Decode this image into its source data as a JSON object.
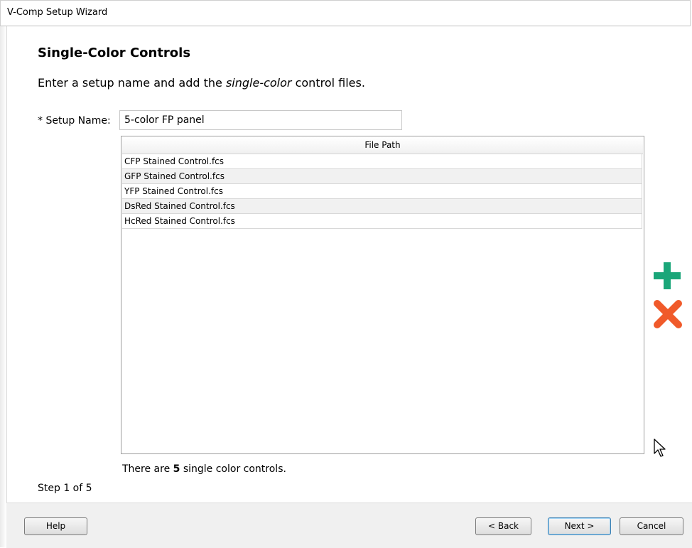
{
  "window": {
    "title": "V-Comp Setup Wizard"
  },
  "page": {
    "heading": "Single-Color Controls",
    "instruction_before": "Enter a setup name and add the ",
    "instruction_emphasis": "single-color",
    "instruction_after": " control files."
  },
  "setup": {
    "label": "* Setup Name:",
    "value": "5-color FP panel"
  },
  "table": {
    "column_header": "File Path",
    "rows": [
      "CFP Stained Control.fcs",
      "GFP Stained Control.fcs",
      "YFP Stained Control.fcs",
      "DsRed Stained Control.fcs",
      "HcRed Stained Control.fcs"
    ]
  },
  "status": {
    "prefix": "There are ",
    "count": "5",
    "suffix": " single color controls."
  },
  "step": "Step 1 of 5",
  "buttons": {
    "help": "Help",
    "back": "< Back",
    "next": "Next >",
    "cancel": "Cancel"
  },
  "icons": {
    "add": "plus-icon",
    "remove": "x-icon",
    "add_color": "#1aa679",
    "remove_color": "#f05a2a"
  }
}
